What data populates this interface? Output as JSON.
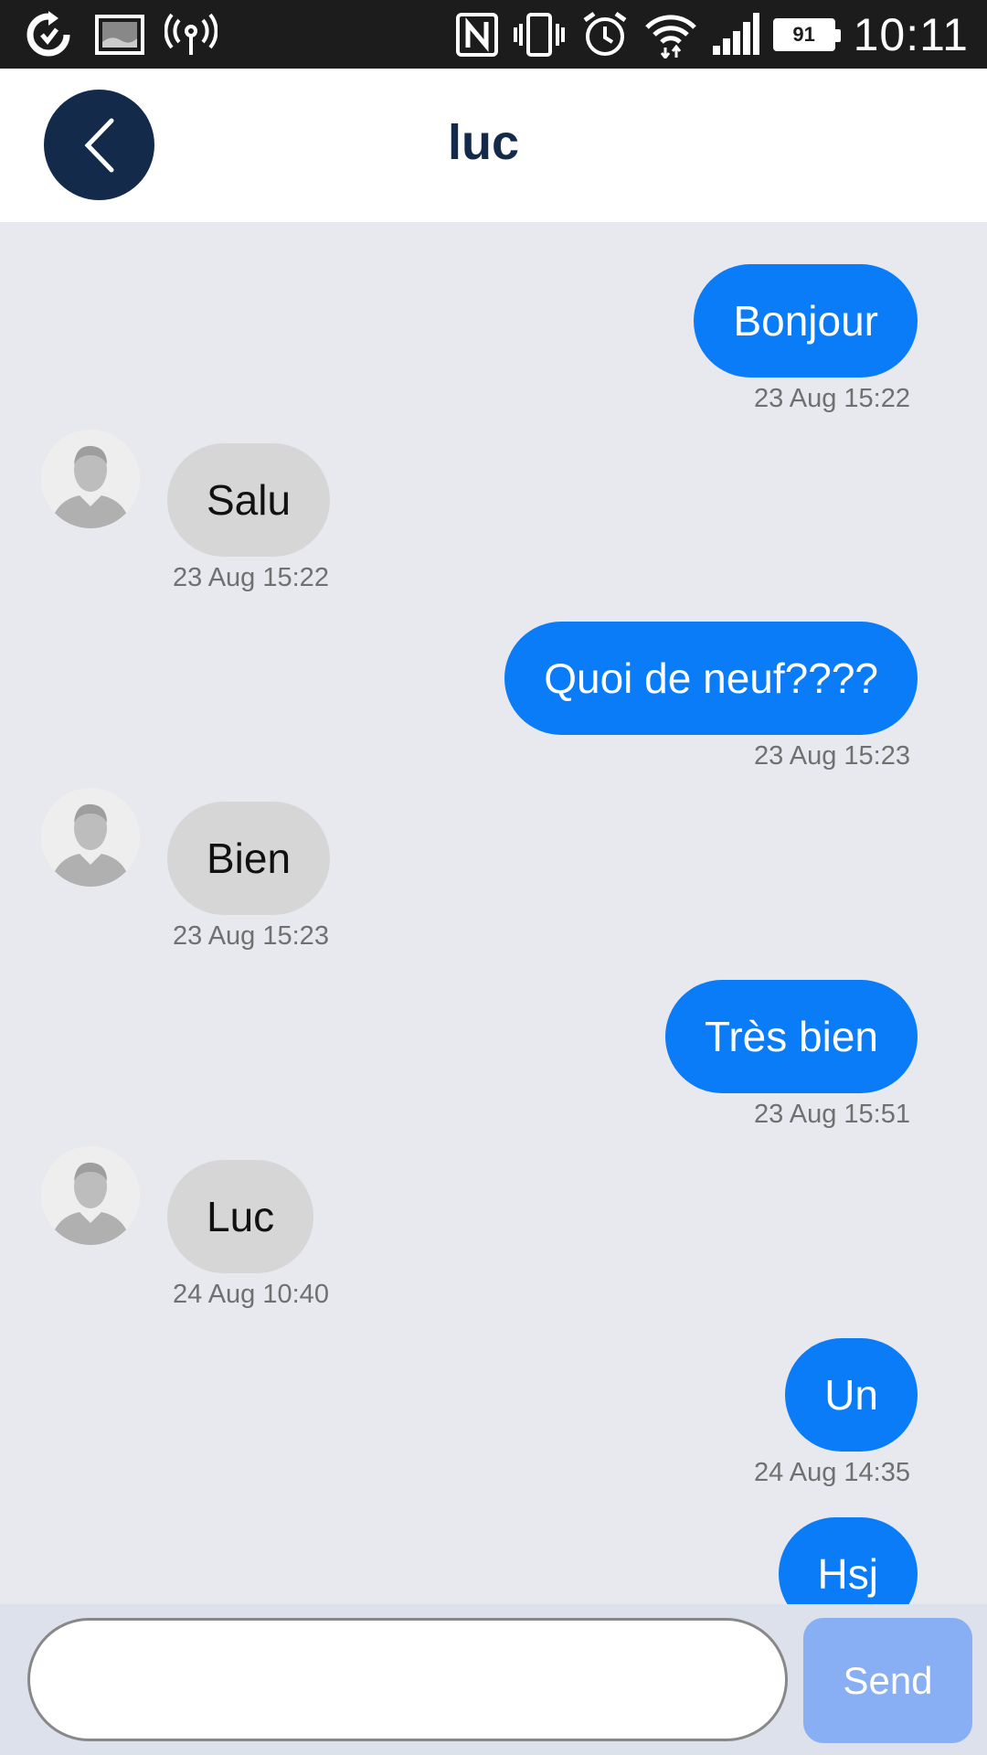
{
  "status_bar": {
    "time": "10:11",
    "battery_level": "91",
    "icons": [
      "sync-icon",
      "image-icon",
      "wireless-tower-icon",
      "nfc-icon",
      "vibrate-icon",
      "alarm-icon",
      "wifi-icon",
      "signal-icon",
      "battery-icon"
    ]
  },
  "header": {
    "title": "luc",
    "back_icon": "chevron-left-icon"
  },
  "messages": [
    {
      "direction": "out",
      "text": "Bonjour",
      "time": "23 Aug 15:22"
    },
    {
      "direction": "in",
      "text": "Salu",
      "time": "23 Aug 15:22"
    },
    {
      "direction": "out",
      "text": "Quoi de neuf????",
      "time": "23 Aug 15:23"
    },
    {
      "direction": "in",
      "text": "Bien",
      "time": "23 Aug 15:23"
    },
    {
      "direction": "out",
      "text": "Très bien",
      "time": "23 Aug 15:51"
    },
    {
      "direction": "in",
      "text": "Luc",
      "time": "24 Aug 10:40"
    },
    {
      "direction": "out",
      "text": "Un",
      "time": "24 Aug 14:35"
    },
    {
      "direction": "out",
      "text": "Hsj",
      "time": ""
    }
  ],
  "composer": {
    "input_value": "",
    "input_placeholder": "",
    "send_label": "Send"
  },
  "colors": {
    "outgoing_bubble": "#0a7cf7",
    "incoming_bubble": "#d6d6d6",
    "header_accent": "#132a4b",
    "send_button": "#88aef3",
    "background": "#e8e8ef"
  }
}
